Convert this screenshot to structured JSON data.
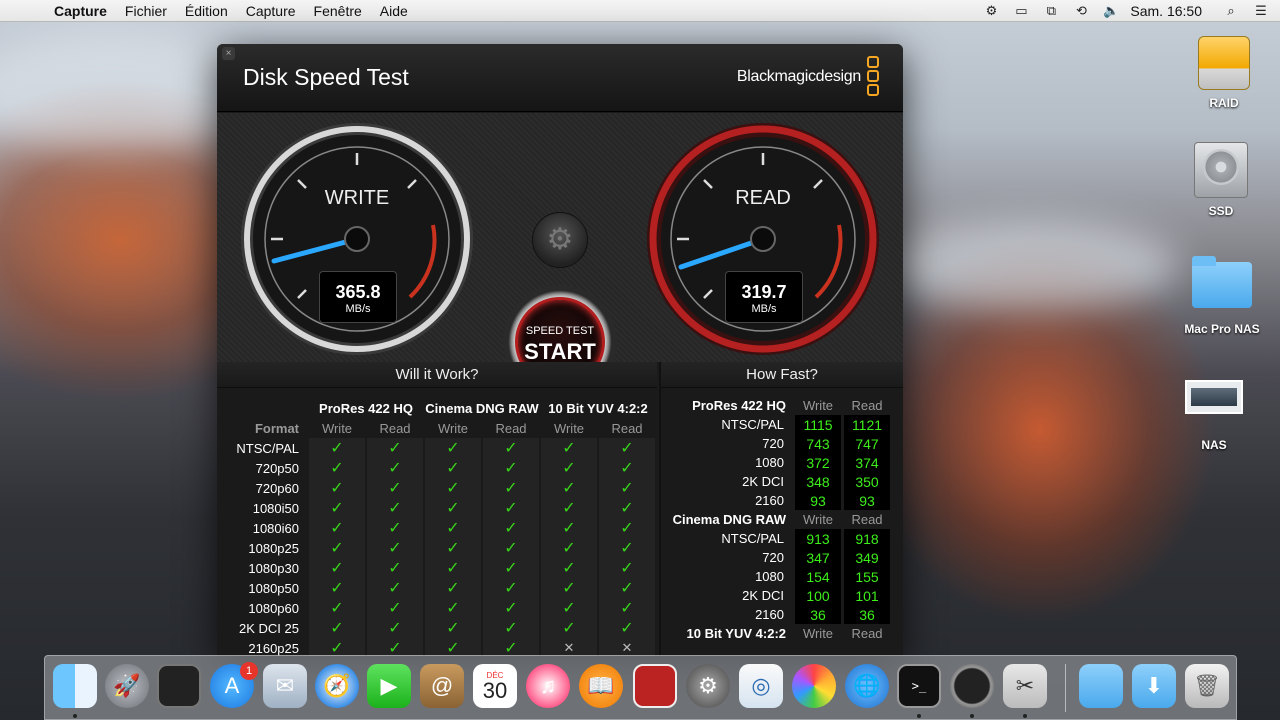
{
  "menubar": {
    "apple": "",
    "app": "Capture",
    "items": [
      "Fichier",
      "Édition",
      "Capture",
      "Fenêtre",
      "Aide"
    ],
    "clock": "Sam. 16:50",
    "status_icons": [
      "screenshot-tool-icon",
      "display-icon",
      "airplay-icon",
      "time-machine-icon",
      "volume-icon",
      "search-icon",
      "list-icon"
    ]
  },
  "desktop": {
    "icons": [
      {
        "label": "RAID",
        "icon": "drive-icon"
      },
      {
        "label": "SSD",
        "icon": "hard-disk-icon"
      },
      {
        "label": "Mac Pro NAS",
        "icon": "folder-icon"
      },
      {
        "label": "NAS",
        "icon": "screenshot-thumbnail-icon"
      }
    ]
  },
  "window": {
    "close": "×",
    "title": "Disk Speed Test",
    "brand": "Blackmagicdesign",
    "write": {
      "label": "WRITE",
      "value": "365.8",
      "unit": "MB/s"
    },
    "read": {
      "label": "READ",
      "value": "319.7",
      "unit": "MB/s"
    },
    "start": {
      "line1": "SPEED TEST",
      "line2": "START"
    },
    "will_it_work": {
      "title": "Will it Work?",
      "format_label": "Format",
      "groups": [
        "ProRes 422 HQ",
        "Cinema DNG RAW",
        "10 Bit YUV 4:2:2"
      ],
      "write_label": "Write",
      "read_label": "Read",
      "rows": [
        {
          "name": "NTSC/PAL",
          "marks": [
            "✓",
            "✓",
            "✓",
            "✓",
            "✓",
            "✓"
          ]
        },
        {
          "name": "720p50",
          "marks": [
            "✓",
            "✓",
            "✓",
            "✓",
            "✓",
            "✓"
          ]
        },
        {
          "name": "720p60",
          "marks": [
            "✓",
            "✓",
            "✓",
            "✓",
            "✓",
            "✓"
          ]
        },
        {
          "name": "1080i50",
          "marks": [
            "✓",
            "✓",
            "✓",
            "✓",
            "✓",
            "✓"
          ]
        },
        {
          "name": "1080i60",
          "marks": [
            "✓",
            "✓",
            "✓",
            "✓",
            "✓",
            "✓"
          ]
        },
        {
          "name": "1080p25",
          "marks": [
            "✓",
            "✓",
            "✓",
            "✓",
            "✓",
            "✓"
          ]
        },
        {
          "name": "1080p30",
          "marks": [
            "✓",
            "✓",
            "✓",
            "✓",
            "✓",
            "✓"
          ]
        },
        {
          "name": "1080p50",
          "marks": [
            "✓",
            "✓",
            "✓",
            "✓",
            "✓",
            "✓"
          ]
        },
        {
          "name": "1080p60",
          "marks": [
            "✓",
            "✓",
            "✓",
            "✓",
            "✓",
            "✓"
          ]
        },
        {
          "name": "2K DCI 25",
          "marks": [
            "✓",
            "✓",
            "✓",
            "✓",
            "✓",
            "✓"
          ]
        },
        {
          "name": "2160p25",
          "marks": [
            "✓",
            "✓",
            "✓",
            "✓",
            "✕",
            "✕"
          ]
        }
      ]
    },
    "how_fast": {
      "title": "How Fast?",
      "write_label": "Write",
      "read_label": "Read",
      "sections": [
        {
          "name": "ProRes 422 HQ",
          "rows": [
            {
              "name": "NTSC/PAL",
              "write": "1115",
              "read": "1121"
            },
            {
              "name": "720",
              "write": "743",
              "read": "747"
            },
            {
              "name": "1080",
              "write": "372",
              "read": "374"
            },
            {
              "name": "2K DCI",
              "write": "348",
              "read": "350"
            },
            {
              "name": "2160",
              "write": "93",
              "read": "93"
            }
          ]
        },
        {
          "name": "Cinema DNG RAW",
          "rows": [
            {
              "name": "NTSC/PAL",
              "write": "913",
              "read": "918"
            },
            {
              "name": "720",
              "write": "347",
              "read": "349"
            },
            {
              "name": "1080",
              "write": "154",
              "read": "155"
            },
            {
              "name": "2K DCI",
              "write": "100",
              "read": "101"
            },
            {
              "name": "2160",
              "write": "36",
              "read": "36"
            }
          ]
        },
        {
          "name": "10 Bit YUV 4:2:2",
          "rows": []
        }
      ]
    }
  },
  "dock": {
    "appstore_badge": "1",
    "calendar_month": "DÉC",
    "calendar_day": "30",
    "apps": [
      "finder-icon",
      "launchpad-icon",
      "photo-booth-icon",
      "app-store-icon",
      "mail-icon",
      "safari-icon",
      "facetime-icon",
      "contacts-icon",
      "calendar-icon",
      "itunes-icon",
      "ibooks-icon",
      "photo-booth-strip-icon",
      "system-preferences-icon",
      "preview-icon",
      "photos-icon",
      "network-icon",
      "terminal-icon",
      "disk-speed-test-icon",
      "grab-icon",
      "applications-folder-icon",
      "downloads-folder-icon",
      "trash-icon"
    ]
  }
}
